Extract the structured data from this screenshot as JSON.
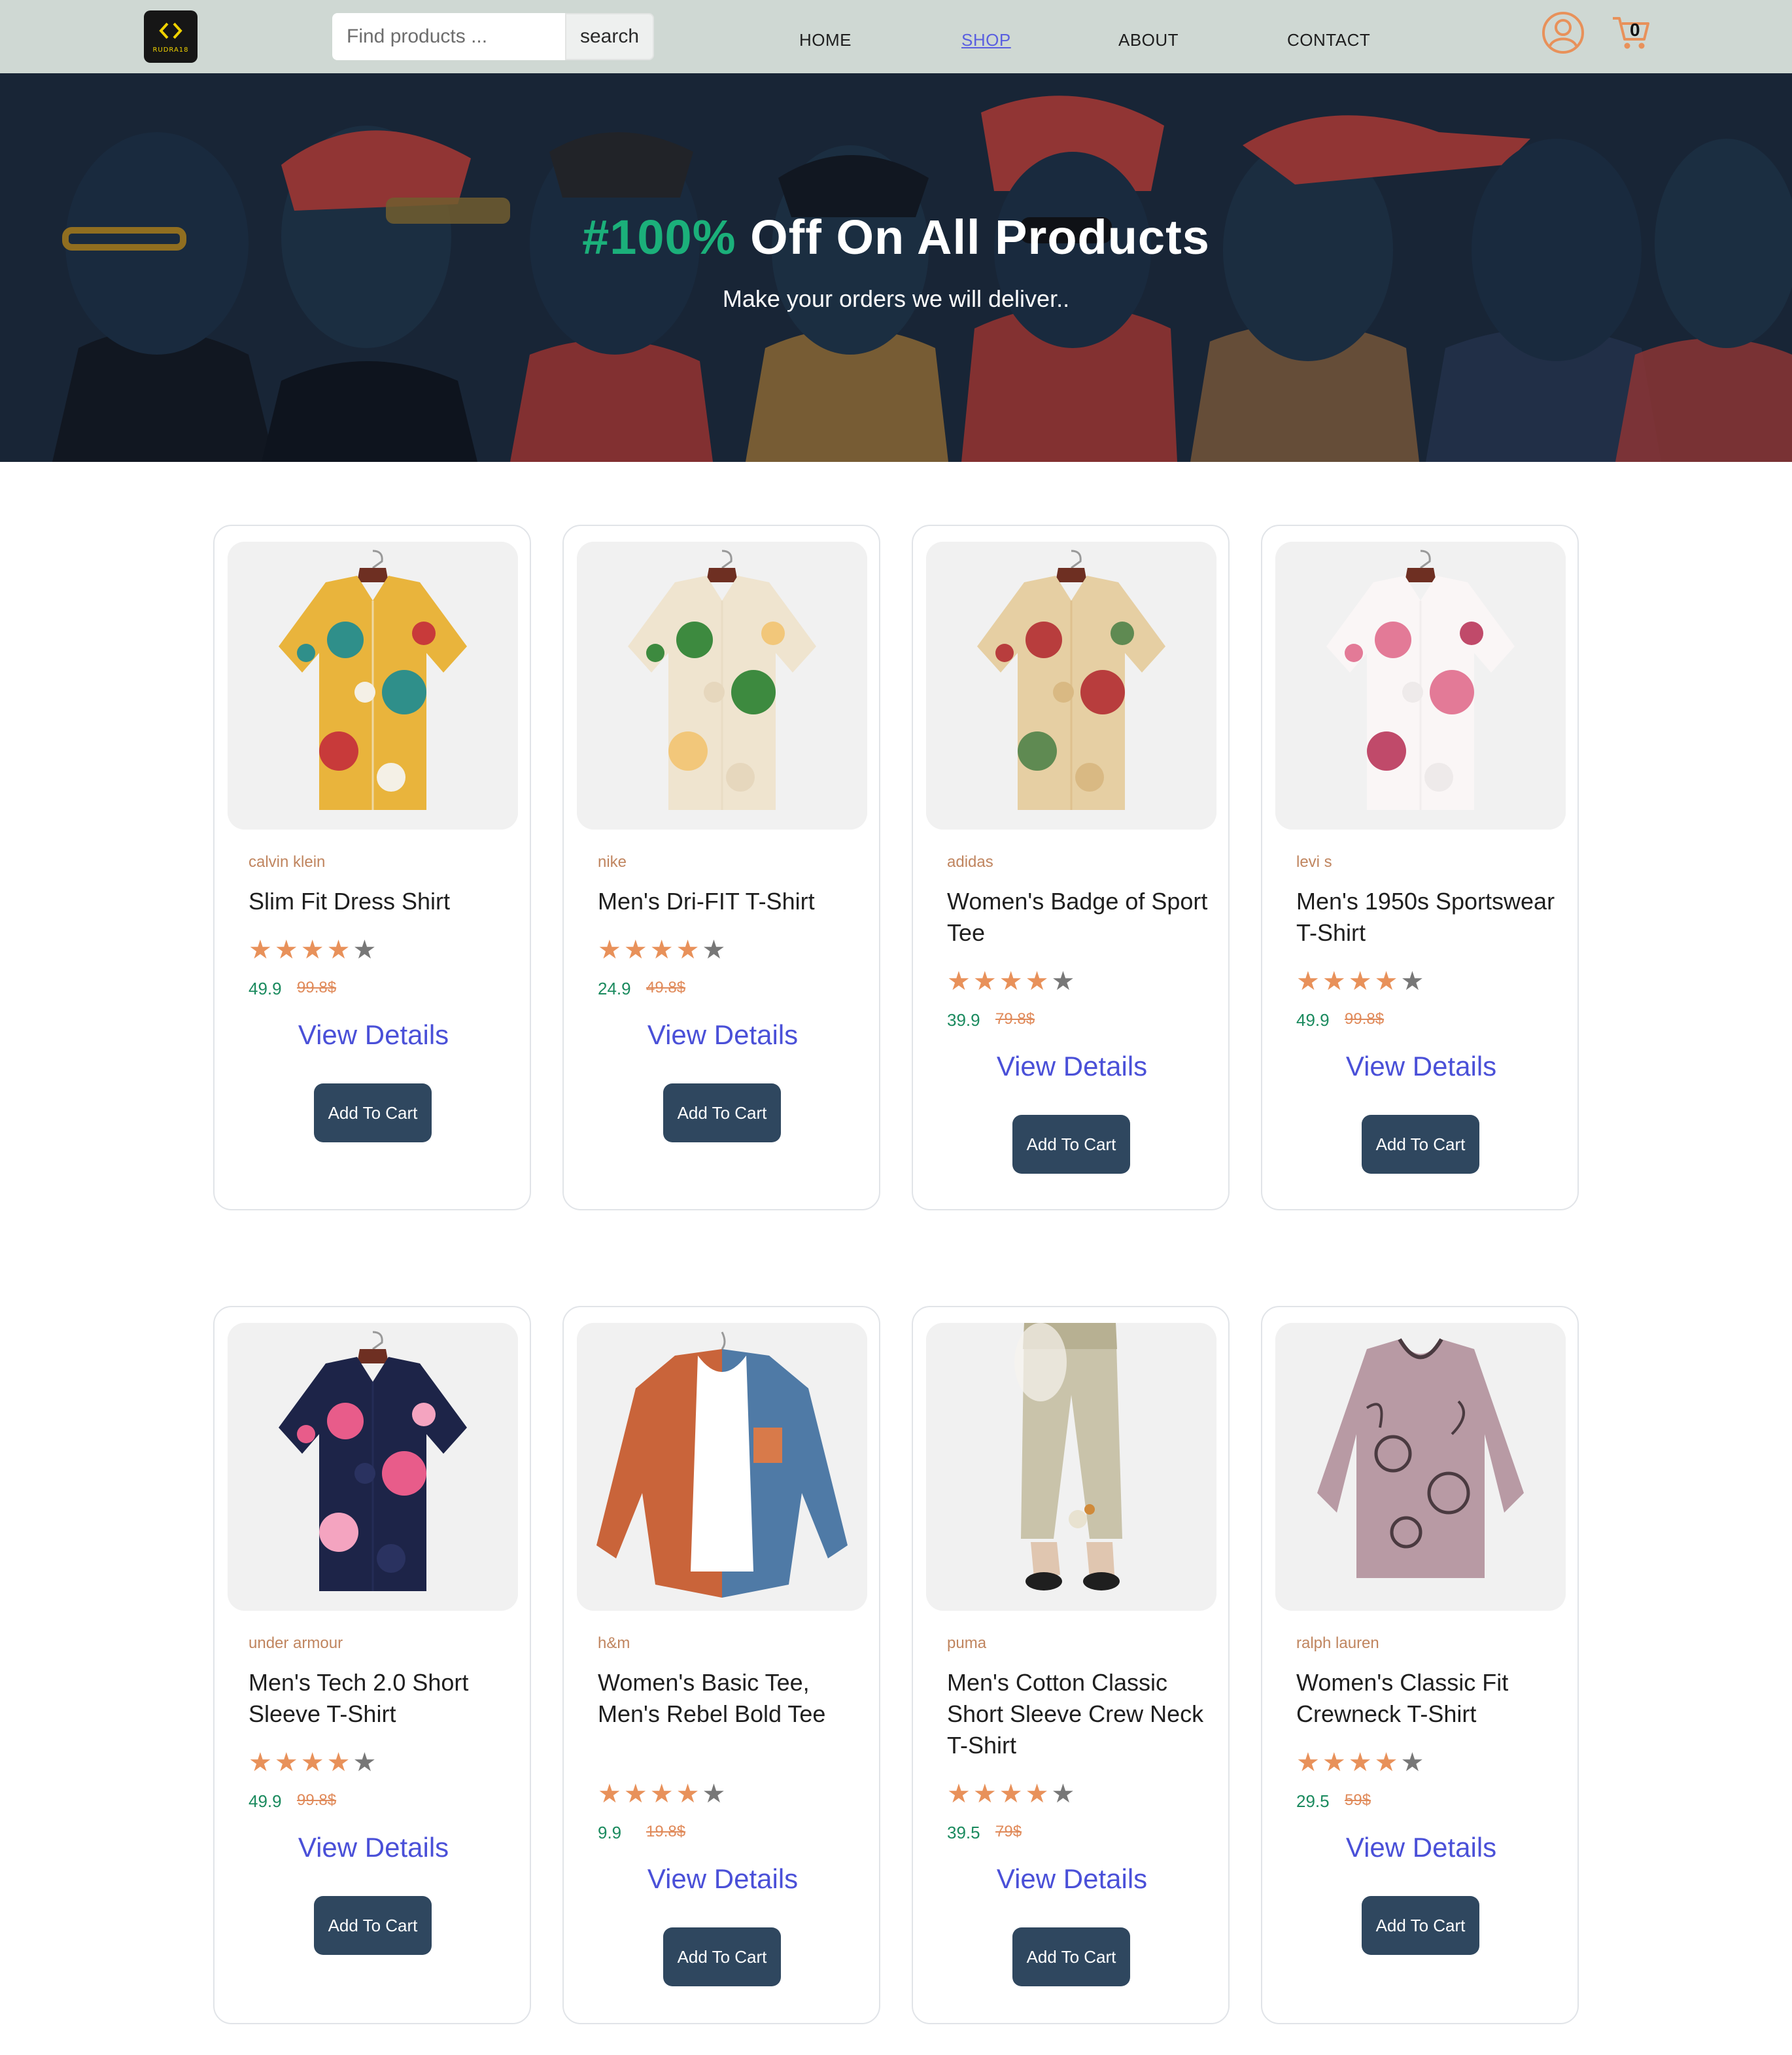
{
  "header": {
    "logo_text": "RUDRA18",
    "search_placeholder": "Find products ...",
    "search_label": "search",
    "nav": [
      "HOME",
      "SHOP",
      "ABOUT",
      "CONTACT"
    ],
    "cart_count": "0"
  },
  "hero": {
    "title_accent": "#100%",
    "title_rest": " Off On All Products",
    "subtitle": "Make your orders we will deliver.."
  },
  "products": [
    {
      "brand": "calvin klein",
      "name": "Slim Fit Dress Shirt",
      "rating": 4,
      "price": "49.9",
      "old_price": "99.8$",
      "view": "View Details",
      "cta": "Add To Cart",
      "colors": [
        "#e9b43c",
        "#2f8f8a",
        "#c83a3a",
        "#f4f0e6"
      ]
    },
    {
      "brand": "nike",
      "name": "Men's Dri-FIT T-Shirt",
      "rating": 4,
      "price": "24.9",
      "old_price": "49.8$",
      "view": "View Details",
      "cta": "Add To Cart",
      "colors": [
        "#efe4cf",
        "#3d8a3f",
        "#f2c77a",
        "#e6d7bd"
      ]
    },
    {
      "brand": "adidas",
      "name": "Women's Badge of Sport Tee",
      "rating": 4,
      "price": "39.9",
      "old_price": "79.8$",
      "view": "View Details",
      "cta": "Add To Cart",
      "colors": [
        "#e6cfa3",
        "#b83d3d",
        "#5f8a52",
        "#d9b983"
      ]
    },
    {
      "brand": "levi s",
      "name": "Men's 1950s Sportswear T-Shirt",
      "rating": 4,
      "price": "49.9",
      "old_price": "99.8$",
      "view": "View Details",
      "cta": "Add To Cart",
      "colors": [
        "#faf6f6",
        "#e37a97",
        "#c04a6a",
        "#eeeaea"
      ]
    },
    {
      "brand": "under armour",
      "name": "Men's Tech 2.0 Short Sleeve T-Shirt",
      "rating": 4,
      "price": "49.9",
      "old_price": "99.8$",
      "view": "View Details",
      "cta": "Add To Cart",
      "colors": [
        "#1d2448",
        "#e85c8a",
        "#f4a4c0",
        "#2a3260"
      ]
    },
    {
      "brand": "h&m",
      "name": "Women's Basic Tee, Men's Rebel Bold Tee",
      "rating": 4,
      "price": "9.9",
      "old_price": "19.8$",
      "view": "View Details",
      "cta": "Add To Cart",
      "colors": [
        "#c9643a",
        "#4f7aa6",
        "#ffffff",
        "#d87a4a"
      ]
    },
    {
      "brand": "puma",
      "name": "Men's Cotton Classic Short Sleeve Crew Neck T-Shirt",
      "rating": 4,
      "price": "39.5",
      "old_price": "79$",
      "view": "View Details",
      "cta": "Add To Cart",
      "colors": [
        "#c9c3aa",
        "#f6f4ee",
        "#1f1f1f",
        "#b7b092"
      ]
    },
    {
      "brand": "ralph lauren",
      "name": "Women's Classic Fit Crewneck T-Shirt",
      "rating": 4,
      "price": "29.5",
      "old_price": "59$",
      "view": "View Details",
      "cta": "Add To Cart",
      "colors": [
        "#b89aa4",
        "#4a3a40",
        "#d5bcc4",
        "#a07f8a"
      ]
    }
  ]
}
